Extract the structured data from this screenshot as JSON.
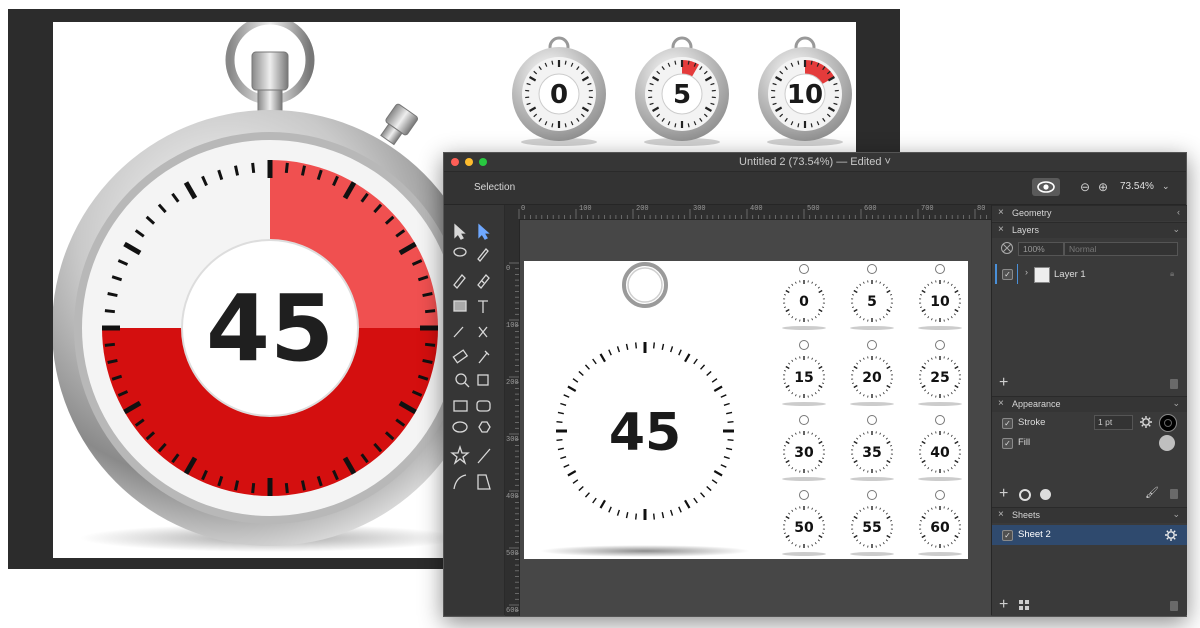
{
  "background": {
    "big_timer_value": "45",
    "small_timers": [
      "0",
      "5",
      "10"
    ]
  },
  "window": {
    "title": "Untitled 2 (73.54%) — Edited ˅",
    "toolbar": {
      "mode_label": "Selection",
      "zoom_level": "73.54%"
    },
    "ruler": {
      "h_labels": [
        "0",
        "100",
        "200",
        "300",
        "400",
        "500",
        "600",
        "700",
        "80"
      ],
      "v_labels": [
        "0",
        "100",
        "200",
        "300",
        "400",
        "500",
        "600"
      ]
    },
    "artboard": {
      "big_value": "45",
      "grid_values": [
        "0",
        "5",
        "10",
        "15",
        "20",
        "25",
        "30",
        "35",
        "40",
        "50",
        "55",
        "60"
      ]
    },
    "panels": {
      "geometry": {
        "title": "Geometry"
      },
      "layers": {
        "title": "Layers",
        "opacity": "100%",
        "blend_mode": "Normal",
        "items": [
          {
            "label": "Layer 1"
          }
        ]
      },
      "appearance": {
        "title": "Appearance",
        "stroke_label": "Stroke",
        "stroke_width": "1 pt",
        "fill_label": "Fill"
      },
      "sheets": {
        "title": "Sheets",
        "items": [
          {
            "label": "Sheet 2"
          }
        ]
      }
    }
  },
  "colors": {
    "accent_red": "#e01010",
    "selected_row": "#2f4a6e",
    "traffic": [
      "#ff5f57",
      "#febc2e",
      "#28c840"
    ]
  }
}
